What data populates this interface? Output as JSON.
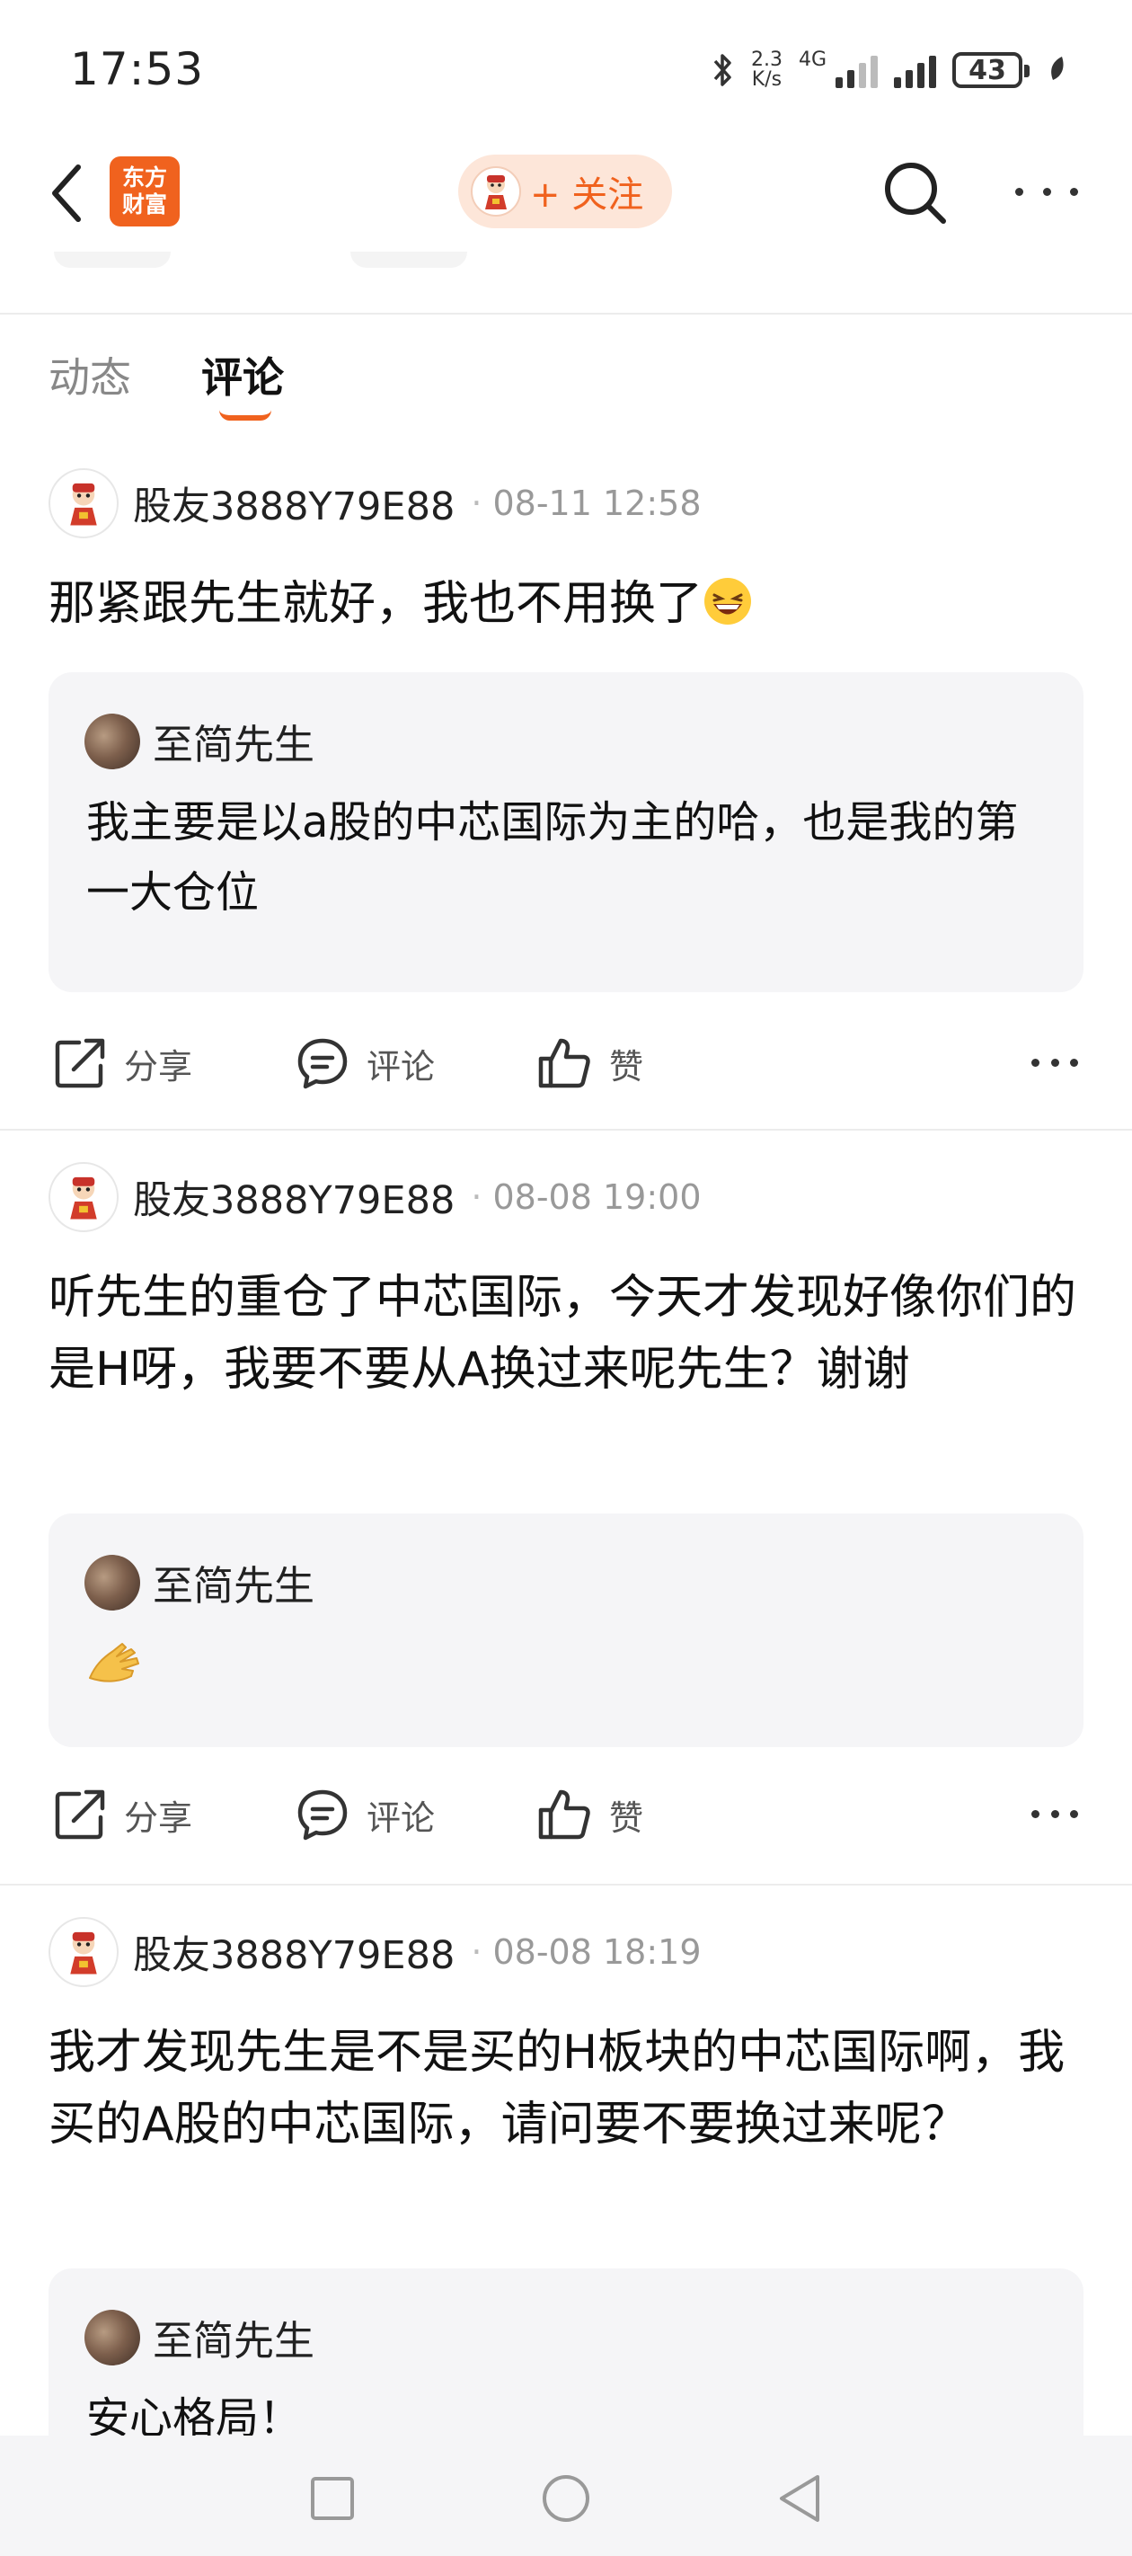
{
  "status_bar": {
    "time": "17:53",
    "net_speed_value": "2.3",
    "net_speed_unit": "K/s",
    "network": "4G",
    "battery": "43",
    "icons": [
      "bluetooth-icon",
      "signal-icon",
      "battery-icon",
      "leaf-icon"
    ]
  },
  "nav": {
    "logo_line1": "东方",
    "logo_line2": "财富",
    "follow_label": "+ 关注",
    "icons": [
      "back-icon",
      "search-icon",
      "more-icon"
    ]
  },
  "tabs": [
    {
      "label": "动态",
      "active": false
    },
    {
      "label": "评论",
      "active": true
    }
  ],
  "comments": [
    {
      "user": "股友3888Y79E88",
      "time": "08-11 12:58",
      "text": "那紧跟先生就好，我也不用换了",
      "emoji": "laughing-emoji",
      "reply": {
        "user": "至简先生",
        "text": "我主要是以a股的中芯国际为主的哈，也是我的第一大仓位"
      }
    },
    {
      "user": "股友3888Y79E88",
      "time": "08-08 19:00",
      "text": "听先生的重仓了中芯国际，今天才发现好像你们的是H呀，我要不要从A换过来呢先生？谢谢",
      "reply": {
        "user": "至简先生",
        "text": "",
        "emoji": "ok-hand-emoji"
      }
    },
    {
      "user": "股友3888Y79E88",
      "time": "08-08 18:19",
      "text": "我才发现先生是不是买的H板块的中芯国际啊，我买的A股的中芯国际，请问要不要换过来呢？",
      "reply": {
        "user": "至简先生",
        "text": "安心格局！"
      }
    }
  ],
  "actions": {
    "share": "分享",
    "comment": "评论",
    "like": "赞"
  },
  "colors": {
    "accent": "#f0621e",
    "follow_bg": "#fde6d9",
    "reply_bg": "#f5f5f7",
    "muted_text": "#999999"
  }
}
